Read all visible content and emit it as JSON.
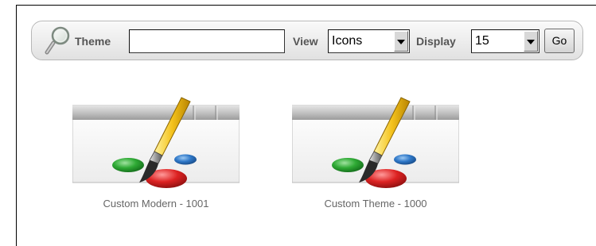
{
  "search_bar": {
    "theme_label": "Theme",
    "theme_value": "",
    "view_label": "View",
    "view_value": "Icons",
    "display_label": "Display",
    "display_value": "15",
    "go_label": "Go",
    "icon": "magnifier-icon"
  },
  "themes": [
    {
      "name": "Custom Modern - 1001",
      "icon": "theme-paintbrush-icon"
    },
    {
      "name": "Custom Theme - 1000",
      "icon": "theme-paintbrush-icon"
    }
  ]
}
